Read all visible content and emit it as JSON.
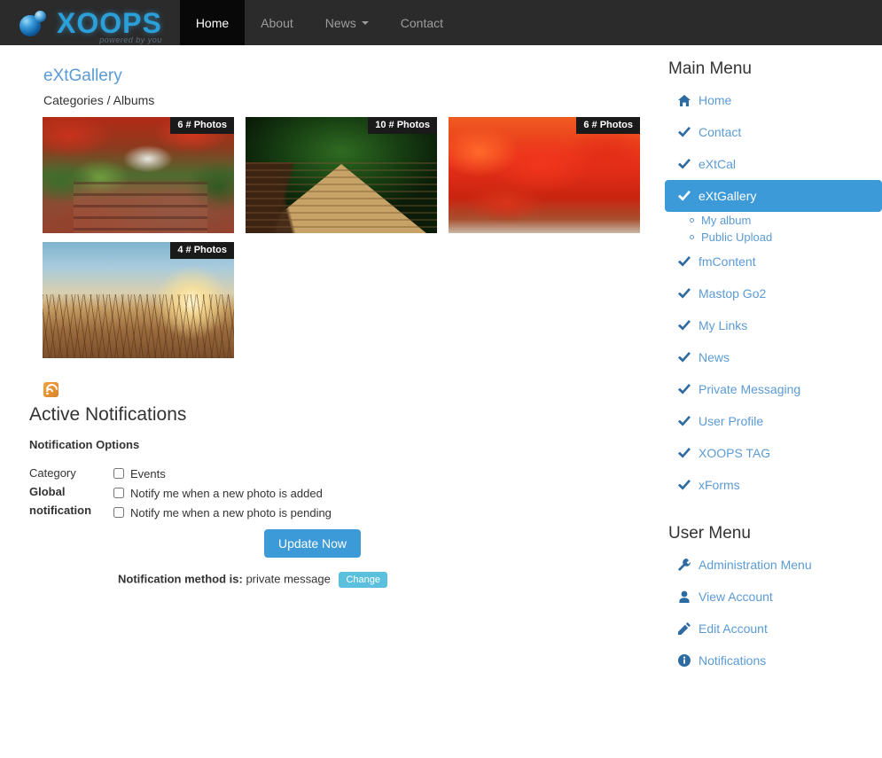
{
  "navbar": {
    "brand_name": "XOOPS",
    "brand_tagline": "powered by you",
    "items": [
      {
        "label": "Home",
        "active": true,
        "caret": false
      },
      {
        "label": "About",
        "active": false,
        "caret": false
      },
      {
        "label": "News",
        "active": false,
        "caret": true
      },
      {
        "label": "Contact",
        "active": false,
        "caret": false
      }
    ]
  },
  "gallery": {
    "title": "eXtGallery",
    "breadcrumb": "Categories / Albums",
    "albums": [
      {
        "badge": "6 # Photos",
        "style": "ph1"
      },
      {
        "badge": "10 # Photos",
        "style": "ph2"
      },
      {
        "badge": "6 # Photos",
        "style": "ph3"
      },
      {
        "badge": "4 # Photos",
        "style": "ph4"
      }
    ]
  },
  "notifications": {
    "heading": "Active Notifications",
    "subheading": "Notification Options",
    "rows": [
      {
        "label": "Category",
        "bold": false
      },
      {
        "label": "Global",
        "bold": true
      },
      {
        "label": "notification",
        "bold": true
      }
    ],
    "options": [
      {
        "label": "Events",
        "checked": false
      },
      {
        "label": "Notify me when a new photo is added",
        "checked": false
      },
      {
        "label": "Notify me when a new photo is pending",
        "checked": false
      }
    ],
    "update_label": "Update Now",
    "method_prefix": "Notification method is:",
    "method_value": "private message",
    "change_label": "Change"
  },
  "sidebar": {
    "main_menu": {
      "title": "Main Menu",
      "items": [
        {
          "label": "Home",
          "icon": "home-icon",
          "active": false
        },
        {
          "label": "Contact",
          "icon": "check-icon",
          "active": false
        },
        {
          "label": "eXtCal",
          "icon": "check-icon",
          "active": false
        },
        {
          "label": "eXtGallery",
          "icon": "check-icon",
          "active": true,
          "children": [
            {
              "label": "My album"
            },
            {
              "label": "Public Upload"
            }
          ]
        },
        {
          "label": "fmContent",
          "icon": "check-icon",
          "active": false
        },
        {
          "label": "Mastop Go2",
          "icon": "check-icon",
          "active": false
        },
        {
          "label": "My Links",
          "icon": "check-icon",
          "active": false
        },
        {
          "label": "News",
          "icon": "check-icon",
          "active": false
        },
        {
          "label": "Private Messaging",
          "icon": "check-icon",
          "active": false
        },
        {
          "label": "User Profile",
          "icon": "check-icon",
          "active": false
        },
        {
          "label": "XOOPS TAG",
          "icon": "check-icon",
          "active": false
        },
        {
          "label": "xForms",
          "icon": "check-icon",
          "active": false
        }
      ]
    },
    "user_menu": {
      "title": "User Menu",
      "items": [
        {
          "label": "Administration Menu",
          "icon": "wrench-icon"
        },
        {
          "label": "View Account",
          "icon": "user-icon"
        },
        {
          "label": "Edit Account",
          "icon": "pencil-icon"
        },
        {
          "label": "Notifications",
          "icon": "info-circle-icon"
        }
      ]
    }
  },
  "colors": {
    "navbar_bg": "#2b2b2b",
    "brand": "#2a9fd8",
    "link": "#5b9bd5",
    "accent": "#3d9ad9",
    "change_btn": "#5bc0de",
    "rss": "#e0912f"
  }
}
